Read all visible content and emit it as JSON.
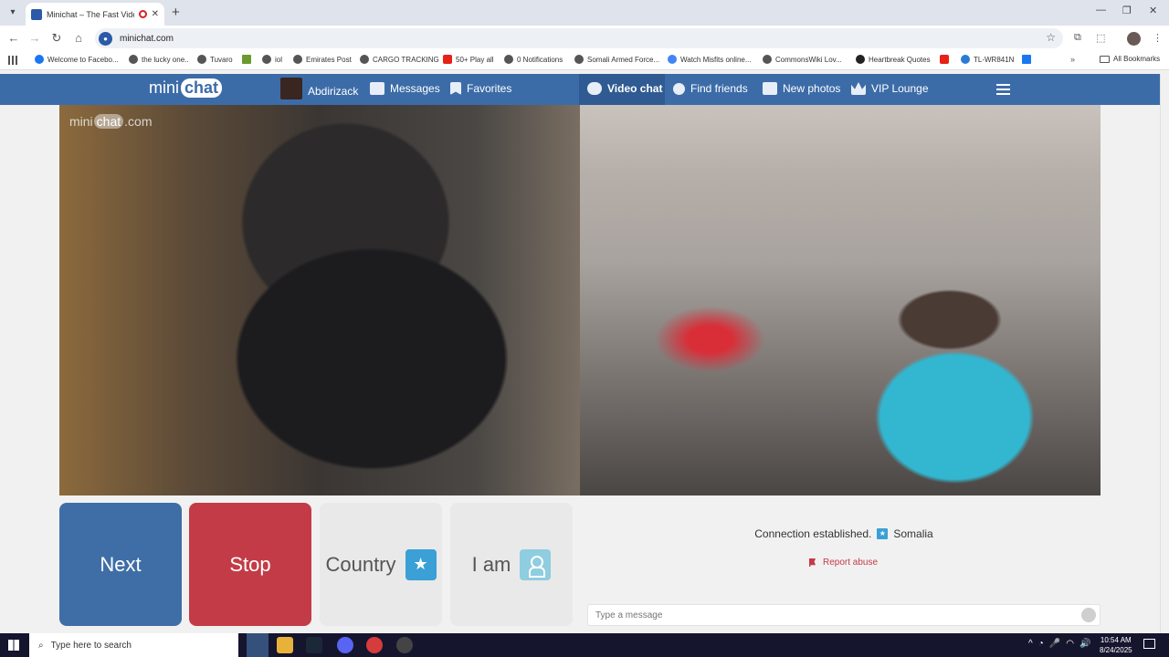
{
  "browser": {
    "tab_title": "Minichat – The Fast Video C",
    "url": "minichat.com",
    "bookmarks": [
      "Welcome to Facebo...",
      "the lucky one..",
      "Tuvaro",
      "iol",
      "Emirates Post",
      "CARGO TRACKING",
      "50+ Play all",
      "0 Notifications",
      "Somali Armed Force...",
      "Watch Misfits online...",
      "CommonsWiki Lov...",
      "Heartbreak Quotes",
      "TL-WR841N"
    ],
    "all_bookmarks": "All Bookmarks"
  },
  "site": {
    "logo_mini": "mini",
    "logo_chat": "chat",
    "nav": {
      "username": "Abdirizack",
      "messages": "Messages",
      "favorites": "Favorites",
      "video_chat": "Video chat",
      "find_friends": "Find friends",
      "new_photos": "New photos",
      "vip_lounge": "VIP Lounge"
    },
    "watermark": {
      "mini": "mini",
      "chat": "chat",
      "com": ".com"
    },
    "controls": {
      "next": "Next",
      "stop": "Stop",
      "country": "Country",
      "iam": "I am"
    },
    "chat": {
      "status": "Connection established.",
      "country": "Somalia",
      "report": "Report abuse",
      "placeholder": "Type a message"
    }
  },
  "taskbar": {
    "search_placeholder": "Type here to search",
    "time": "10:54 AM",
    "date": "8/24/2025"
  }
}
